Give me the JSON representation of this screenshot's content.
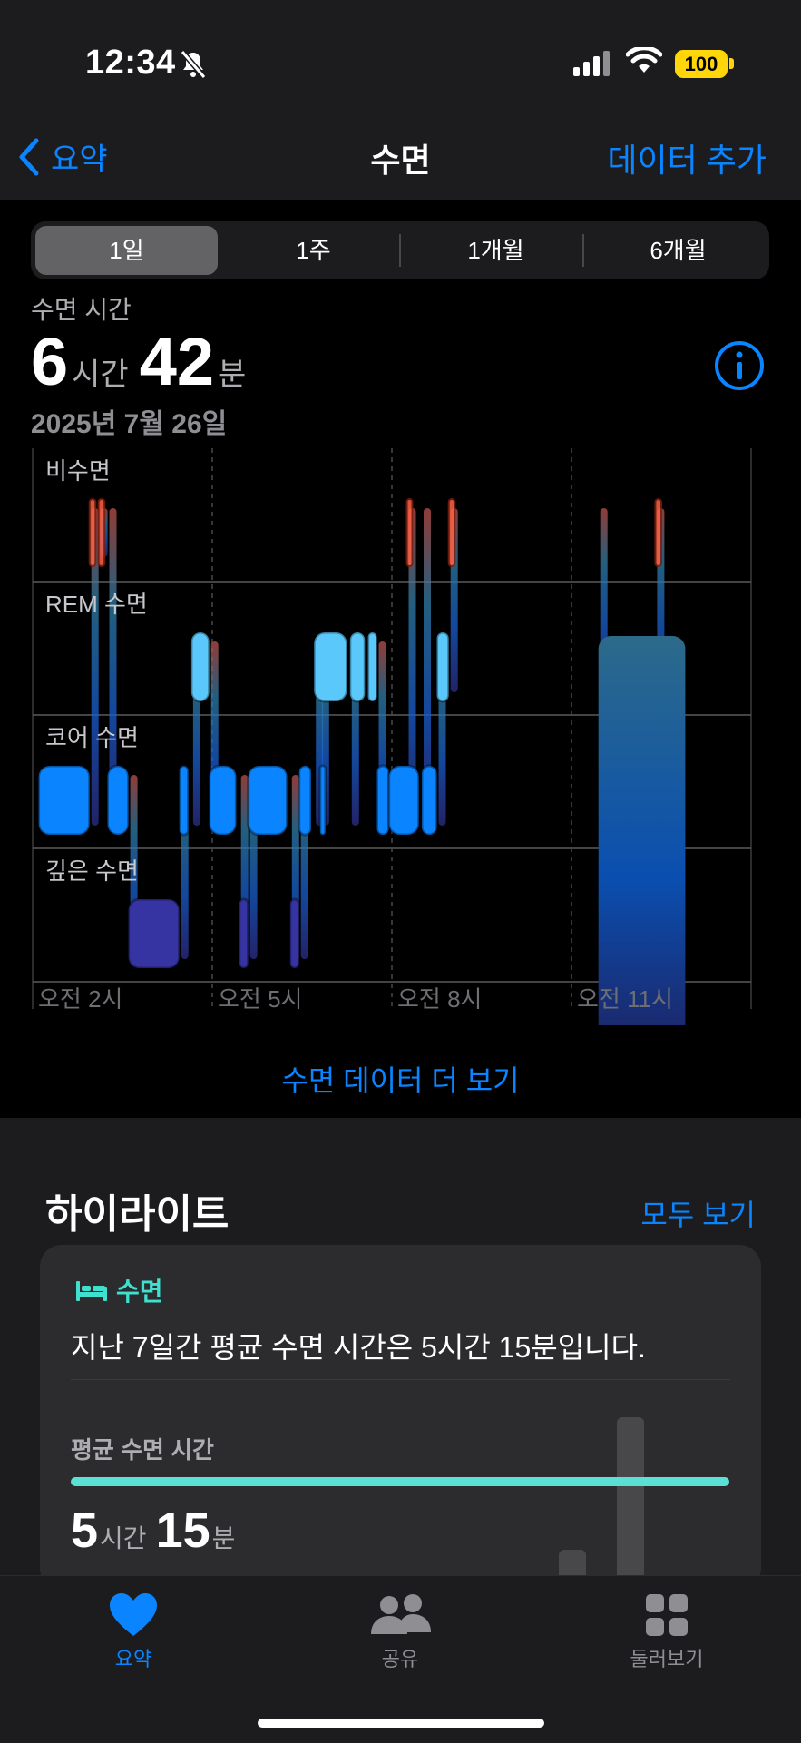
{
  "status_bar": {
    "time": "12:34",
    "battery": "100"
  },
  "nav": {
    "back_label": "요약",
    "title": "수면",
    "add_label": "데이터 추가"
  },
  "segments": [
    "1일",
    "1주",
    "1개월",
    "6개월"
  ],
  "metric": {
    "label": "수면 시간",
    "hours": "6",
    "hours_unit": "시간",
    "minutes": "42",
    "minutes_unit": "분",
    "date": "2025년 7월 26일"
  },
  "chart_data": {
    "type": "sleep-stage-timeline",
    "stages": [
      "비수면",
      "REM 수면",
      "코어 수면",
      "깊은 수면"
    ],
    "x_ticks": [
      "오전 2시",
      "오전 5시",
      "오전 8시",
      "오전 11시"
    ],
    "stage_colors": {
      "비수면": "#ff6347",
      "REM 수면": "#5ac8fa",
      "코어 수면": "#0a84ff",
      "깊은 수면": "#3634a3"
    },
    "segments": [
      {
        "stage": "코어 수면",
        "start": 1.1,
        "end": 1.95
      },
      {
        "stage": "비수면",
        "start": 1.95,
        "end": 2.05
      },
      {
        "stage": "비수면",
        "start": 2.1,
        "end": 2.2
      },
      {
        "stage": "코어 수면",
        "start": 2.25,
        "end": 2.6
      },
      {
        "stage": "깊은 수면",
        "start": 2.6,
        "end": 3.45
      },
      {
        "stage": "코어 수면",
        "start": 3.45,
        "end": 3.6
      },
      {
        "stage": "REM 수면",
        "start": 3.65,
        "end": 3.95
      },
      {
        "stage": "코어 수면",
        "start": 3.95,
        "end": 4.4
      },
      {
        "stage": "깊은 수면",
        "start": 4.45,
        "end": 4.6
      },
      {
        "stage": "코어 수면",
        "start": 4.6,
        "end": 5.25
      },
      {
        "stage": "깊은 수면",
        "start": 5.3,
        "end": 5.45
      },
      {
        "stage": "코어 수면",
        "start": 5.45,
        "end": 5.65
      },
      {
        "stage": "REM 수면",
        "start": 5.7,
        "end": 6.25
      },
      {
        "stage": "REM 수면",
        "start": 6.3,
        "end": 6.55
      },
      {
        "stage": "REM 수면",
        "start": 6.6,
        "end": 6.75
      },
      {
        "stage": "코어 수면",
        "start": 5.8,
        "end": 5.85
      },
      {
        "stage": "코어 수면",
        "start": 6.75,
        "end": 6.95
      },
      {
        "stage": "코어 수면",
        "start": 6.95,
        "end": 7.45
      },
      {
        "stage": "코어 수면",
        "start": 7.5,
        "end": 7.75
      },
      {
        "stage": "비수면",
        "start": 7.25,
        "end": 7.32
      },
      {
        "stage": "REM 수면",
        "start": 7.75,
        "end": 7.95
      },
      {
        "stage": "비수면",
        "start": 7.95,
        "end": 8.05
      },
      {
        "stage": "REM 수면",
        "start": 10.45,
        "end": 11.9
      },
      {
        "stage": "비수면",
        "start": 11.4,
        "end": 11.5
      }
    ]
  },
  "more_link": "수면 데이터 더 보기",
  "highlights": {
    "title": "하이라이트",
    "see_all": "모두 보기",
    "card": {
      "category": "수면",
      "text": "지난 7일간 평균 수면 시간은 5시간 15분입니다.",
      "sub_label": "평균 수면 시간",
      "hours": "5",
      "hours_unit": "시간",
      "minutes": "15",
      "minutes_unit": "분"
    }
  },
  "tabs": [
    {
      "label": "요약",
      "icon": "heart-icon",
      "active": true
    },
    {
      "label": "공유",
      "icon": "people-icon",
      "active": false
    },
    {
      "label": "둘러보기",
      "icon": "grid-icon",
      "active": false
    }
  ]
}
